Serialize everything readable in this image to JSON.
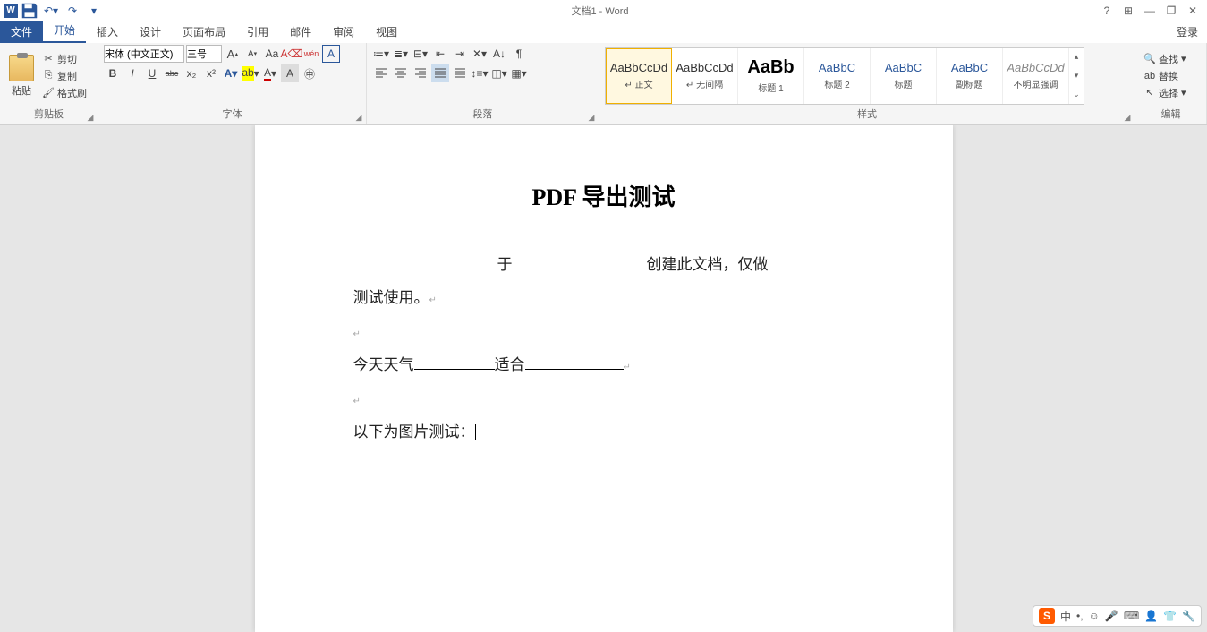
{
  "window": {
    "title": "文档1 - Word",
    "login": "登录"
  },
  "qat": {
    "save": "保存",
    "undo": "撤销",
    "redo": "恢复"
  },
  "wincontrols": {
    "help": "?",
    "ribbonopts": "⊞",
    "min": "—",
    "restore": "❐",
    "close": "✕"
  },
  "tabs": {
    "file": "文件",
    "home": "开始",
    "insert": "插入",
    "design": "设计",
    "layout": "页面布局",
    "references": "引用",
    "mailings": "邮件",
    "review": "审阅",
    "view": "视图"
  },
  "clipboard": {
    "label": "剪贴板",
    "paste": "粘贴",
    "cut": "剪切",
    "copy": "复制",
    "painter": "格式刷"
  },
  "font": {
    "label": "字体",
    "name": "宋体 (中文正文)",
    "size": "三号",
    "bold": "B",
    "italic": "I",
    "underline": "U",
    "strike": "abc",
    "sub": "x₂",
    "sup": "x²",
    "grow": "A",
    "shrink": "A",
    "case": "Aa",
    "clear": "⌫",
    "phonetic": "wén",
    "charborder": "A",
    "texteffect": "A",
    "highlight": "A",
    "fontcolor": "A",
    "charshade": "A"
  },
  "paragraph": {
    "label": "段落",
    "bullets": "•",
    "numbering": "1",
    "multilevel": "≡",
    "decindent": "⇤",
    "incindent": "⇥",
    "sort": "A↓",
    "showmarks": "¶",
    "alignl": "≡",
    "alignc": "≡",
    "alignr": "≡",
    "justify": "≡",
    "distribute": "≡",
    "linespace": "↕",
    "shading": "▭",
    "borders": "▦",
    "asian": "✕",
    "snap": "⬚"
  },
  "styles": {
    "label": "样式",
    "items": [
      {
        "preview": "AaBbCcDd",
        "name": "↵ 正文",
        "sel": true
      },
      {
        "preview": "AaBbCcDd",
        "name": "↵ 无间隔"
      },
      {
        "preview": "AaBb",
        "name": "标题 1",
        "big": true,
        "color": "#000"
      },
      {
        "preview": "AaBbC",
        "name": "标题 2",
        "color": "#2b579a"
      },
      {
        "preview": "AaBbC",
        "name": "标题",
        "color": "#2b579a"
      },
      {
        "preview": "AaBbC",
        "name": "副标题",
        "color": "#2b579a"
      },
      {
        "preview": "AaBbCcDd",
        "name": "不明显强调",
        "italic": true
      }
    ]
  },
  "editing": {
    "label": "编辑",
    "find": "查找",
    "replace": "替换",
    "select": "选择"
  },
  "document": {
    "heading": "PDF 导出测试",
    "p1_a": "",
    "p1_mid": "于",
    "p1_b": "创建此文档，仅做",
    "p1_c": "测试使用。",
    "p2_a": "今天天气",
    "p2_mid": "适合",
    "p2_end": "",
    "p3": "以下为图片测试："
  },
  "ime": {
    "brand": "S",
    "lang": "中",
    "punct": "•,",
    "face": "☺",
    "mic": "🎤",
    "kbd": "⌨",
    "person": "👤",
    "shirt": "👕",
    "tool": "🔧"
  }
}
